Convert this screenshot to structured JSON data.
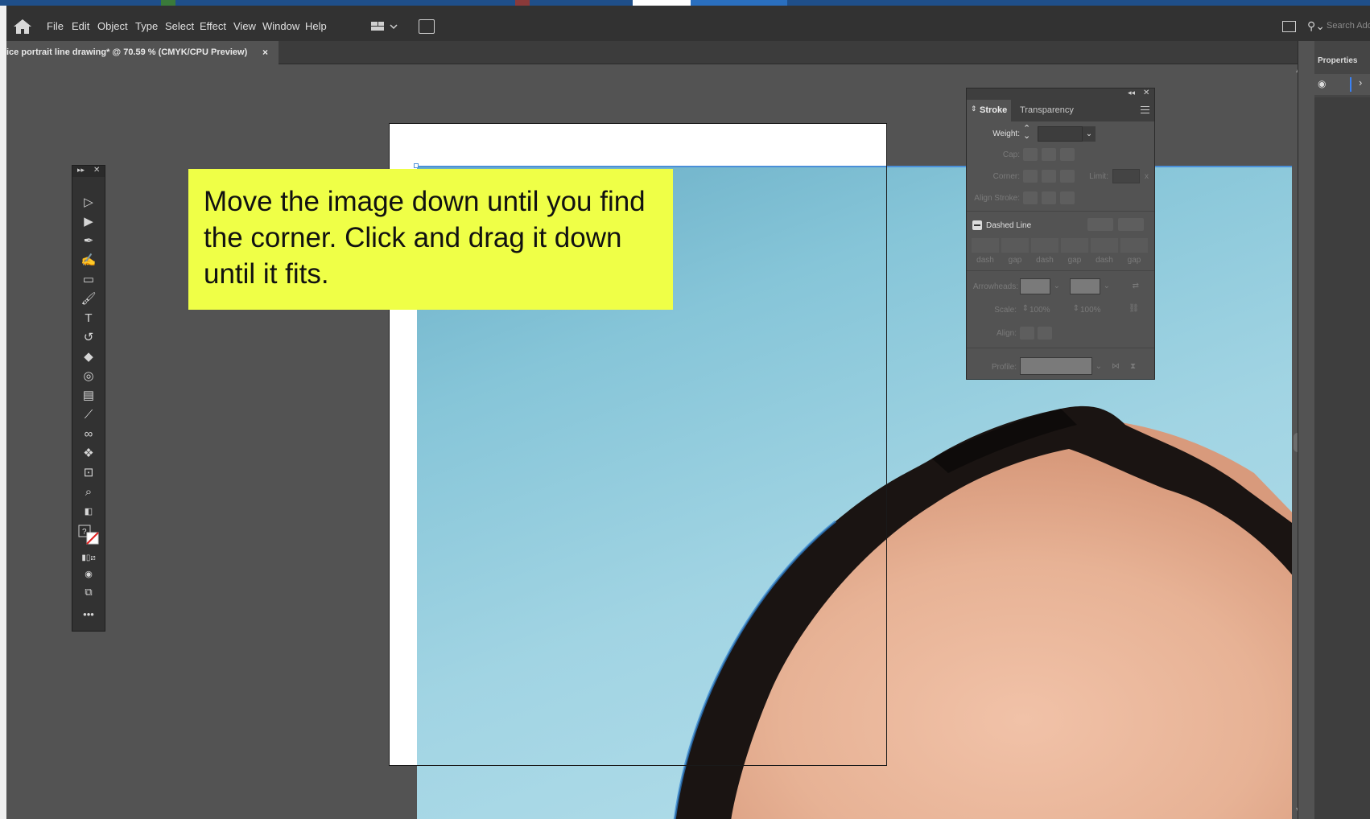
{
  "menubar": {
    "items": [
      "File",
      "Edit",
      "Object",
      "Type",
      "Select",
      "Effect",
      "View",
      "Window",
      "Help"
    ],
    "search_placeholder": "Search Adob"
  },
  "document_tab": {
    "title": "ice portrait line drawing* @ 70.59 % (CMYK/CPU Preview)",
    "close": "×"
  },
  "callout": {
    "text": "Move the image down until you find the corner. Click and drag it down until it fits."
  },
  "stroke_panel": {
    "tab_stroke": "Stroke",
    "tab_transparency": "Transparency",
    "weight_label": "Weight:",
    "cap_label": "Cap:",
    "corner_label": "Corner:",
    "limit_label": "Limit:",
    "limit_suffix": "x",
    "align_stroke_label": "Align Stroke:",
    "dashed_line_label": "Dashed Line",
    "dash_labels": [
      "dash",
      "gap",
      "dash",
      "gap",
      "dash",
      "gap"
    ],
    "arrowheads_label": "Arrowheads:",
    "scale_label": "Scale:",
    "scale_values": [
      "100%",
      "100%"
    ],
    "align_label": "Align:",
    "profile_label": "Profile:"
  },
  "properties_panel": {
    "title": "Properties"
  },
  "tools": [
    "selection-tool",
    "direct-selection-tool",
    "pen-tool",
    "curvature-tool",
    "rectangle-tool",
    "paintbrush-tool",
    "type-tool",
    "rotate-tool",
    "eraser-tool",
    "shape-builder-tool",
    "gradient-tool",
    "eyedropper-tool",
    "blend-tool",
    "symbol-sprayer-tool",
    "artboard-tool",
    "zoom-tool"
  ],
  "colors": {
    "callout_bg": "#efff47",
    "selection_blue": "#4a8fd8",
    "ui_dark": "#323232",
    "canvas_gray": "#535353"
  }
}
